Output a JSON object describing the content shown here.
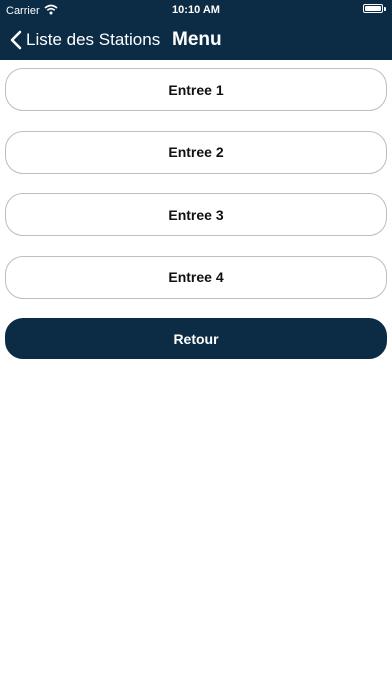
{
  "status_bar": {
    "carrier": "Carrier",
    "time": "10:10 AM",
    "wifi_icon": "wifi-icon",
    "battery_icon": "battery-icon"
  },
  "nav": {
    "back_label": "Liste des Stations",
    "title": "Menu",
    "back_icon": "chevron-left-icon"
  },
  "menu": {
    "items": [
      {
        "label": "Entree 1"
      },
      {
        "label": "Entree 2"
      },
      {
        "label": "Entree 3"
      },
      {
        "label": "Entree 4"
      }
    ],
    "back_button_label": "Retour"
  },
  "colors": {
    "primary": "#0c2c46",
    "button_border": "#bdbdbd",
    "background": "#ffffff"
  }
}
